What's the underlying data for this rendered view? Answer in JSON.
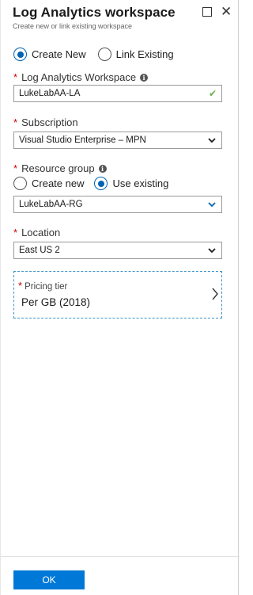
{
  "header": {
    "title": "Log Analytics workspace",
    "subtitle": "Create new or link existing workspace"
  },
  "mode": {
    "options": [
      {
        "label": "Create New",
        "selected": true
      },
      {
        "label": "Link Existing",
        "selected": false
      }
    ]
  },
  "workspace": {
    "label": "Log Analytics Workspace",
    "value": "LukeLabAA-LA"
  },
  "subscription": {
    "label": "Subscription",
    "value": "Visual Studio Enterprise – MPN"
  },
  "resource_group": {
    "label": "Resource group",
    "options": [
      {
        "label": "Create new",
        "selected": false
      },
      {
        "label": "Use existing",
        "selected": true
      }
    ],
    "value": "LukeLabAA-RG"
  },
  "location": {
    "label": "Location",
    "value": "East US 2"
  },
  "pricing": {
    "label": "Pricing tier",
    "value": "Per GB (2018)"
  },
  "footer": {
    "ok_label": "OK"
  },
  "colors": {
    "accent": "#0078d7",
    "radio_selected": "#0063b1",
    "required": "#cc0000",
    "valid_check": "#6ab04c",
    "pricing_border": "#3a93c8"
  }
}
